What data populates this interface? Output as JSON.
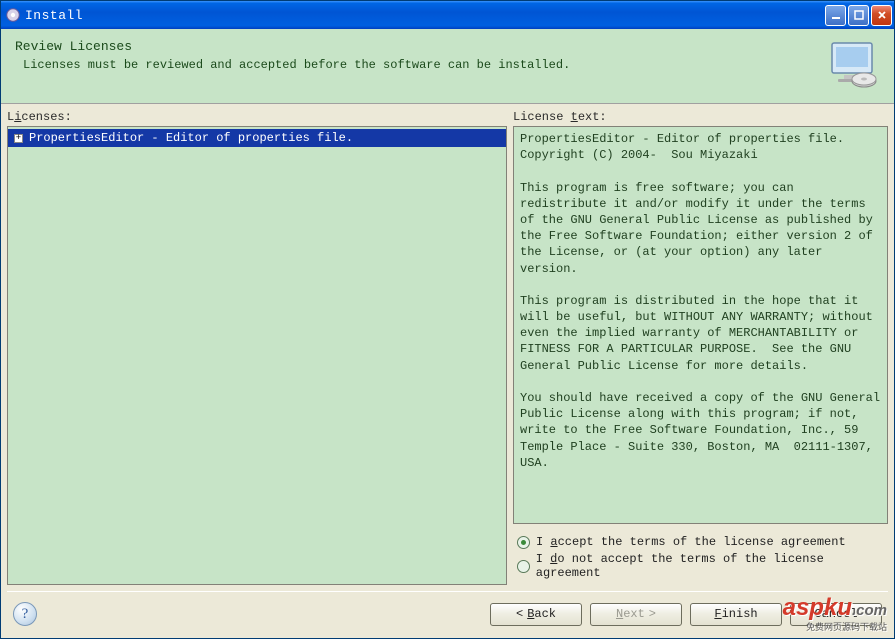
{
  "window": {
    "title": "Install"
  },
  "header": {
    "title": "Review Licenses",
    "subtitle": "Licenses must be reviewed and accepted before the software can be installed."
  },
  "left": {
    "label_pre": "L",
    "label_mn": "i",
    "label_post": "censes:",
    "items": [
      {
        "label": "PropertiesEditor - Editor of properties file."
      }
    ]
  },
  "right": {
    "label_pre": "License ",
    "label_mn": "t",
    "label_post": "ext:",
    "text": "PropertiesEditor - Editor of properties file.\nCopyright (C) 2004-  Sou Miyazaki\n\nThis program is free software; you can redistribute it and/or modify it under the terms of the GNU General Public License as published by the Free Software Foundation; either version 2 of the License, or (at your option) any later version.\n\nThis program is distributed in the hope that it will be useful, but WITHOUT ANY WARRANTY; without even the implied warranty of MERCHANTABILITY or FITNESS FOR A PARTICULAR PURPOSE.  See the GNU General Public License for more details.\n\nYou should have received a copy of the GNU General Public License along with this program; if not, write to the Free Software Foundation, Inc., 59 Temple Place - Suite 330, Boston, MA  02111-1307, USA."
  },
  "radios": {
    "accept_pre": "I ",
    "accept_mn": "a",
    "accept_post": "ccept the terms of the license agreement",
    "decline_pre": "I ",
    "decline_mn": "d",
    "decline_post": "o not accept the terms of the license agreement",
    "selected": "accept"
  },
  "footer": {
    "back_arrow": "<",
    "back_mn": "B",
    "back_post": "ack",
    "next_mn": "N",
    "next_post": "ext",
    "next_arrow": ">",
    "finish_mn": "F",
    "finish_post": "inish",
    "cancel": "Cancel"
  },
  "watermark": {
    "main": "aspku",
    "sub": "免费网页源码下载站"
  }
}
